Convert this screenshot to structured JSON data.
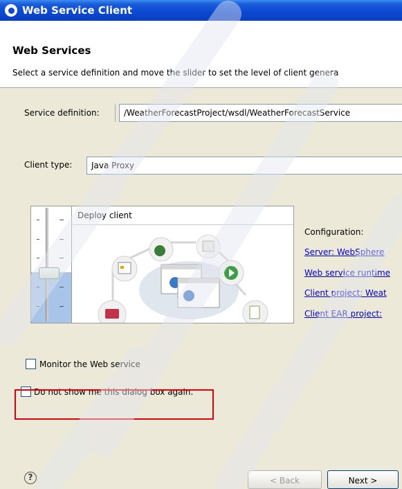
{
  "window": {
    "title": "Web Service Client"
  },
  "banner": {
    "title": "Web Services",
    "description": "Select a service definition and move the slider to set the level of client genera"
  },
  "service": {
    "label": "Service definition:",
    "value": "/WeatherForecastProject/wsdl/WeatherForecastService"
  },
  "client": {
    "label": "Client type:",
    "value": "Java Proxy"
  },
  "slider": {
    "level_label": "Deploy client",
    "level_fraction": 0.5
  },
  "configuration": {
    "heading": "Configuration:",
    "links": [
      "Server: WebSphere",
      "Web service runtime",
      "Client project: Weat",
      "Client EAR project:"
    ]
  },
  "options": {
    "monitor": "Monitor the Web service",
    "do_not_show": "Do not show me this dialog box again."
  },
  "buttons": {
    "back": "< Back",
    "next": "Next >"
  },
  "icons": {
    "title": "eclipse-icon",
    "help": "help-icon",
    "help_glyph": "?"
  },
  "colors": {
    "titlebar": "#0a48d0",
    "highlight": "#e0000b",
    "link": "#0000cc"
  }
}
